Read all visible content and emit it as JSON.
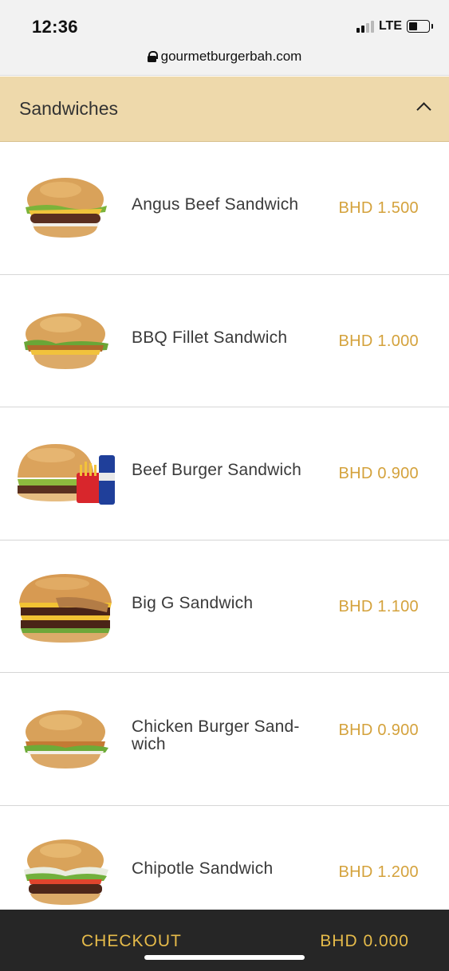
{
  "status_bar": {
    "time": "12:36",
    "network": "LTE",
    "signal_bars_active": 2,
    "signal_bars_total": 4,
    "battery_level": 0.45
  },
  "browser": {
    "url": "gourmetburgerbah.com"
  },
  "category": {
    "title": "Sandwiches",
    "expanded": true
  },
  "items": [
    {
      "name": "Angus Beef Sandwich",
      "price": "BHD 1.500",
      "image": "burger-image"
    },
    {
      "name": "BBQ Fillet Sandwich",
      "price": "BHD 1.000",
      "image": "burger-image"
    },
    {
      "name": "Beef Burger Sandwich",
      "price": "BHD 0.900",
      "image": "burger-meal-image"
    },
    {
      "name": "Big G Sandwich",
      "price": "BHD 1.100",
      "image": "burger-image"
    },
    {
      "name": "Chicken Burger Sand-wich",
      "price": "BHD 0.900",
      "image": "burger-image"
    },
    {
      "name": "Chipotle Sandwich",
      "price": "BHD 1.200",
      "image": "burger-image"
    }
  ],
  "footer": {
    "checkout_label": "CHECKOUT",
    "total": "BHD 0.000"
  },
  "colors": {
    "category_bg": "#eed9ab",
    "price": "#d4a23c",
    "footer_bg": "#262626",
    "footer_text": "#e6bb4a"
  }
}
